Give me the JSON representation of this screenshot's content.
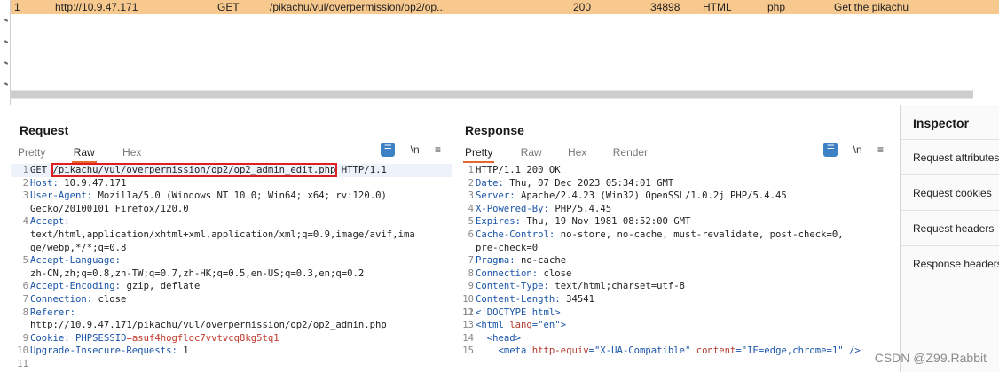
{
  "history": {
    "row": {
      "num": "1",
      "host": "http://10.9.47.171",
      "method": "GET",
      "url": "/pikachu/vul/overpermission/op2/op...",
      "status": "200",
      "length": "34898",
      "mime": "HTML",
      "ext": "php",
      "title": "Get the pikachu"
    }
  },
  "request": {
    "title": "Request",
    "tabs": [
      "Pretty",
      "Raw",
      "Hex"
    ],
    "active_tab": "Raw",
    "lines": {
      "l1_method": "GET ",
      "l1_path": "/pikachu/vul/overpermission/op2/op2_admin_edit.php",
      "l1_proto": " HTTP/1.1",
      "l2_key": "Host",
      "l2_val": " 10.9.47.171",
      "l3_key": "User-Agent",
      "l3_val": " Mozilla/5.0 (Windows NT 10.0; Win64; x64; rv:120.0)",
      "l3_cont": "Gecko/20100101 Firefox/120.0",
      "l4_key": "Accept",
      "l4_val1": "text/html,application/xhtml+xml,application/xml;q=0.9,image/avif,ima",
      "l4_val2": "ge/webp,*/*;q=0.8",
      "l5_key": "Accept-Language",
      "l5_val": "zh-CN,zh;q=0.8,zh-TW;q=0.7,zh-HK;q=0.5,en-US;q=0.3,en;q=0.2",
      "l6_key": "Accept-Encoding",
      "l6_val": " gzip, deflate",
      "l7_key": "Connection",
      "l7_val": " close",
      "l8_key": "Referer",
      "l8_val": "http://10.9.47.171/pikachu/vul/overpermission/op2/op2_admin.php",
      "l9_key": "Cookie",
      "l9_name": " PHPSESSID",
      "l9_val": "=asuf4hogfloc7vvtvcq8kg5tq1",
      "l10_key": "Upgrade-Insecure-Requests",
      "l10_val": " 1"
    }
  },
  "response": {
    "title": "Response",
    "tabs": [
      "Pretty",
      "Raw",
      "Hex",
      "Render"
    ],
    "active_tab": "Pretty",
    "lines": {
      "l1": "HTTP/1.1 200 OK",
      "l2_key": "Date",
      "l2_val": " Thu, 07 Dec 2023 05:34:01 GMT",
      "l3_key": "Server",
      "l3_val": " Apache/2.4.23 (Win32) OpenSSL/1.0.2j PHP/5.4.45",
      "l4_key": "X-Powered-By",
      "l4_val": " PHP/5.4.45",
      "l5_key": "Expires",
      "l5_val": " Thu, 19 Nov 1981 08:52:00 GMT",
      "l6_key": "Cache-Control",
      "l6_val": " no-store, no-cache, must-revalidate, post-check=0,",
      "l6_cont": "pre-check=0",
      "l7_key": "Pragma",
      "l7_val": " no-cache",
      "l8_key": "Connection",
      "l8_val": " close",
      "l9_key": "Content-Type",
      "l9_val": " text/html;charset=utf-8",
      "l10_key": "Content-Length",
      "l10_val": " 34541",
      "l12": "<!DOCTYPE html>",
      "l13_open": "<html ",
      "l13_attr": "lang",
      "l13_val": "=\"en\"",
      "l13_close": ">",
      "l14": "<head>",
      "l15_open": "<meta ",
      "l15_attr1": "http-equiv",
      "l15_val1": "=\"X-UA-Compatible\" ",
      "l15_attr2": "content",
      "l15_val2": "=\"IE=edge,chrome=1\" />"
    }
  },
  "inspector": {
    "title": "Inspector",
    "items": [
      "Request attributes",
      "Request cookies",
      "Request headers",
      "Response headers"
    ]
  },
  "tools": {
    "newline": "\\n",
    "menu": "≡",
    "wrap": "☰"
  },
  "watermark": "CSDN @Z99.Rabbit"
}
